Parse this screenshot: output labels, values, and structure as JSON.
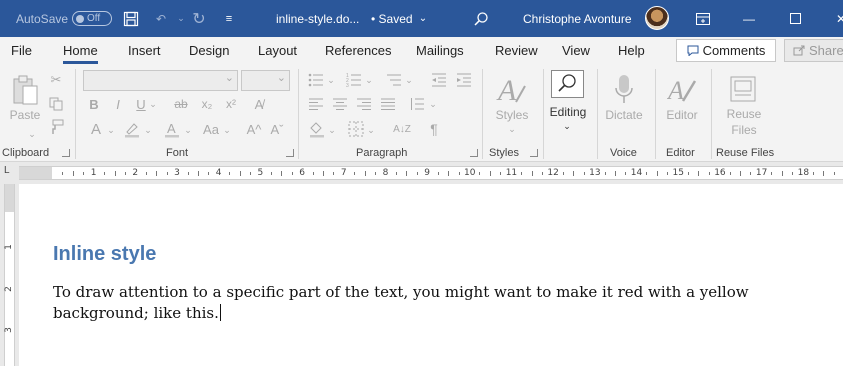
{
  "titlebar": {
    "autosave_label": "AutoSave",
    "autosave_state": "Off",
    "document_name": "inline-style.do...",
    "save_status": "• Saved",
    "user_name": "Christophe Avonture"
  },
  "menu": {
    "tabs": [
      "File",
      "Home",
      "Insert",
      "Design",
      "Layout",
      "References",
      "Mailings",
      "Review",
      "View",
      "Help"
    ],
    "active_tab": "Home",
    "comments_label": "Comments",
    "share_label": "Share"
  },
  "ribbon": {
    "clipboard": {
      "label": "Clipboard",
      "paste_label": "Paste"
    },
    "font": {
      "label": "Font"
    },
    "paragraph": {
      "label": "Paragraph"
    },
    "styles": {
      "label": "Styles",
      "button_label": "Styles"
    },
    "editing": {
      "button_label": "Editing"
    },
    "voice": {
      "label": "Voice",
      "dictate_label": "Dictate"
    },
    "editor": {
      "label": "Editor",
      "button_label": "Editor"
    },
    "reuse": {
      "label": "Reuse Files",
      "button_line1": "Reuse",
      "button_line2": "Files"
    }
  },
  "ruler": {
    "marks": [
      "1",
      "2",
      "3",
      "4",
      "5",
      "6",
      "7",
      "8",
      "9",
      "10",
      "11",
      "12",
      "13",
      "14",
      "15",
      "16",
      "17",
      "18"
    ],
    "vertical_marks": [
      "1",
      "2",
      "3"
    ]
  },
  "document": {
    "heading": "Inline style",
    "paragraph": "To draw attention to a specific part of the text, you might want to make it red with a yellow background; like this."
  },
  "colors": {
    "titlebar": "#2b579a",
    "heading": "#4a78b0",
    "accent": "#2b579a"
  }
}
